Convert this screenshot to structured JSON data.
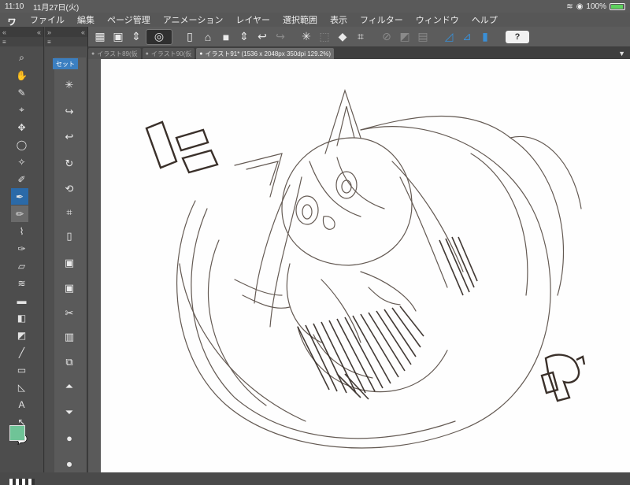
{
  "status_bar": {
    "time": "11:10",
    "date": "11月27日(火)",
    "battery": "100%"
  },
  "menu": [
    "ファイル",
    "編集",
    "ページ管理",
    "アニメーション",
    "レイヤー",
    "選択範囲",
    "表示",
    "フィルター",
    "ウィンドウ",
    "ヘルプ"
  ],
  "tabs": [
    {
      "label": "イラスト89(仮"
    },
    {
      "label": "イラスト90(仮"
    },
    {
      "label": "イラスト91* (1536 x 2048px 350dpi 129.2%)"
    }
  ],
  "command_bar": {
    "set_label": "セット"
  },
  "colors": {
    "main": "#6fc497",
    "sub": "#ffffff",
    "accent": "#3b7fc1",
    "sketch_line": "#4a3e36"
  },
  "canvas_lettering": {
    "left": "に",
    "right": "や"
  },
  "icons": [
    "search-icon",
    "hand-icon",
    "pen-icon",
    "eraser-icon",
    "fill-icon",
    "gradient-icon",
    "undo-icon",
    "redo-icon",
    "help-icon"
  ]
}
